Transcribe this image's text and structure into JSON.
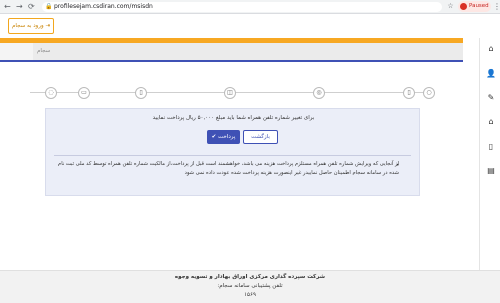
{
  "browser": {
    "url": "profilesejam.csdiran.com/msisdn",
    "paused_label": "Paused",
    "back_icon": "arrow-left-icon",
    "forward_icon": "arrow-right-icon",
    "reload_icon": "reload-icon",
    "menu_icon": "kebab-menu-icon"
  },
  "topbar": {
    "login_label": "ورود به سجام"
  },
  "breadcrumb": {
    "label": "سجام"
  },
  "stepper": {
    "steps": [
      "◌",
      "▭",
      "▯",
      "◫",
      "◎",
      "▯",
      "○"
    ]
  },
  "panel": {
    "notice": "برای تغییر شماره تلفن همراه شما باید مبلغ ۵۰,۰۰۰ ریال پرداخت نمایید",
    "back_label": "بازگشت",
    "pay_label": "✔ پرداخت",
    "bullet_text": "از آنجایی که ویرایش شماره تلفن همراه مستلزم پرداخت هزینه می باشد، خواهشمند است قبل از پرداخت،از مالکیت شماره تلفن همراه توسط کد ملی ثبت نام شده در سامانه سجام اطمینان حاصل نماییدر غیر اینصورت هزینه پرداخت شده عودت داده نمی شود"
  },
  "sidebar": {
    "icons": [
      "home-icon",
      "user-icon",
      "edit-icon",
      "bank-icon",
      "mobile-icon",
      "document-icon"
    ]
  },
  "footer": {
    "line1": "شرکت سپرده گذاری مرکزی اوراق بهادار و تسویه وجوه",
    "line2": "تلفن پشتیبانی سامانه سجام:",
    "line3": "۱۵۶۹"
  },
  "colors": {
    "accent": "#3f51b5",
    "brand_orange": "#f7a823",
    "panel_bg": "#ebeef8"
  }
}
